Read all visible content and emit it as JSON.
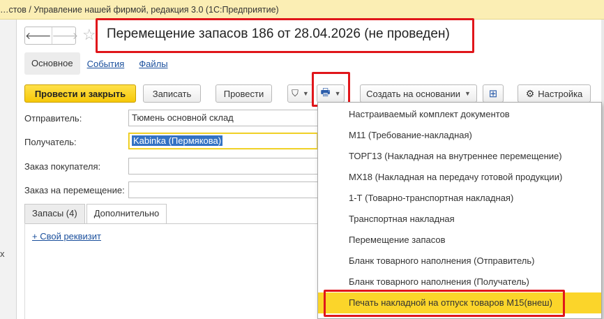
{
  "window": {
    "title": "…стов / Управление нашей фирмой, редакция 3.0  (1С:Предприятие)"
  },
  "nav": {
    "back_glyph": "🡐",
    "forward_glyph": "🡒",
    "star_glyph": "☆"
  },
  "document": {
    "title": "Перемещение запасов 186 от 28.04.2026 (не проведен)"
  },
  "top_tabs": {
    "main": "Основное",
    "events": "События",
    "files": "Файлы"
  },
  "toolbar": {
    "post_close": "Провести и закрыть",
    "save": "Записать",
    "post": "Провести",
    "filter_glyph": "⛉",
    "print_glyph": "🖶",
    "create_based": "Создать на основании",
    "structure_glyph": "⊞",
    "settings_glyph": "⚙",
    "settings": "Настройка"
  },
  "form": {
    "sender_label": "Отправитель:",
    "sender_value": "Тюмень основной склад",
    "recipient_label": "Получатель:",
    "recipient_value": "Kabinka (Пермякова)",
    "customer_order_label": "Заказ покупателя:",
    "customer_order_value": "",
    "transfer_order_label": "Заказ на перемещение:",
    "transfer_order_value": ""
  },
  "bottom_tabs": {
    "stock": "Запасы (4)",
    "additional": "Дополнительно"
  },
  "add_attribute": "+ Свой реквизит",
  "left_cut_text": "х",
  "print_menu": {
    "items": [
      "Настраиваемый комплект документов",
      "М11 (Требование-накладная)",
      "ТОРГ13 (Накладная на внутреннее перемещение)",
      "МХ18 (Накладная на передачу готовой продукции)",
      "1-Т (Товарно-транспортная накладная)",
      "Транспортная накладная",
      "Перемещение запасов",
      "Бланк товарного наполнения (Отправитель)",
      "Бланк товарного наполнения (Получатель)",
      "Печать накладной на отпуск товаров М15(внеш)"
    ],
    "highlight_color": "#fbd52a"
  },
  "colors": {
    "accent": "#f6c808",
    "annotation_red": "#e0161b",
    "link": "#1a4f9c"
  }
}
